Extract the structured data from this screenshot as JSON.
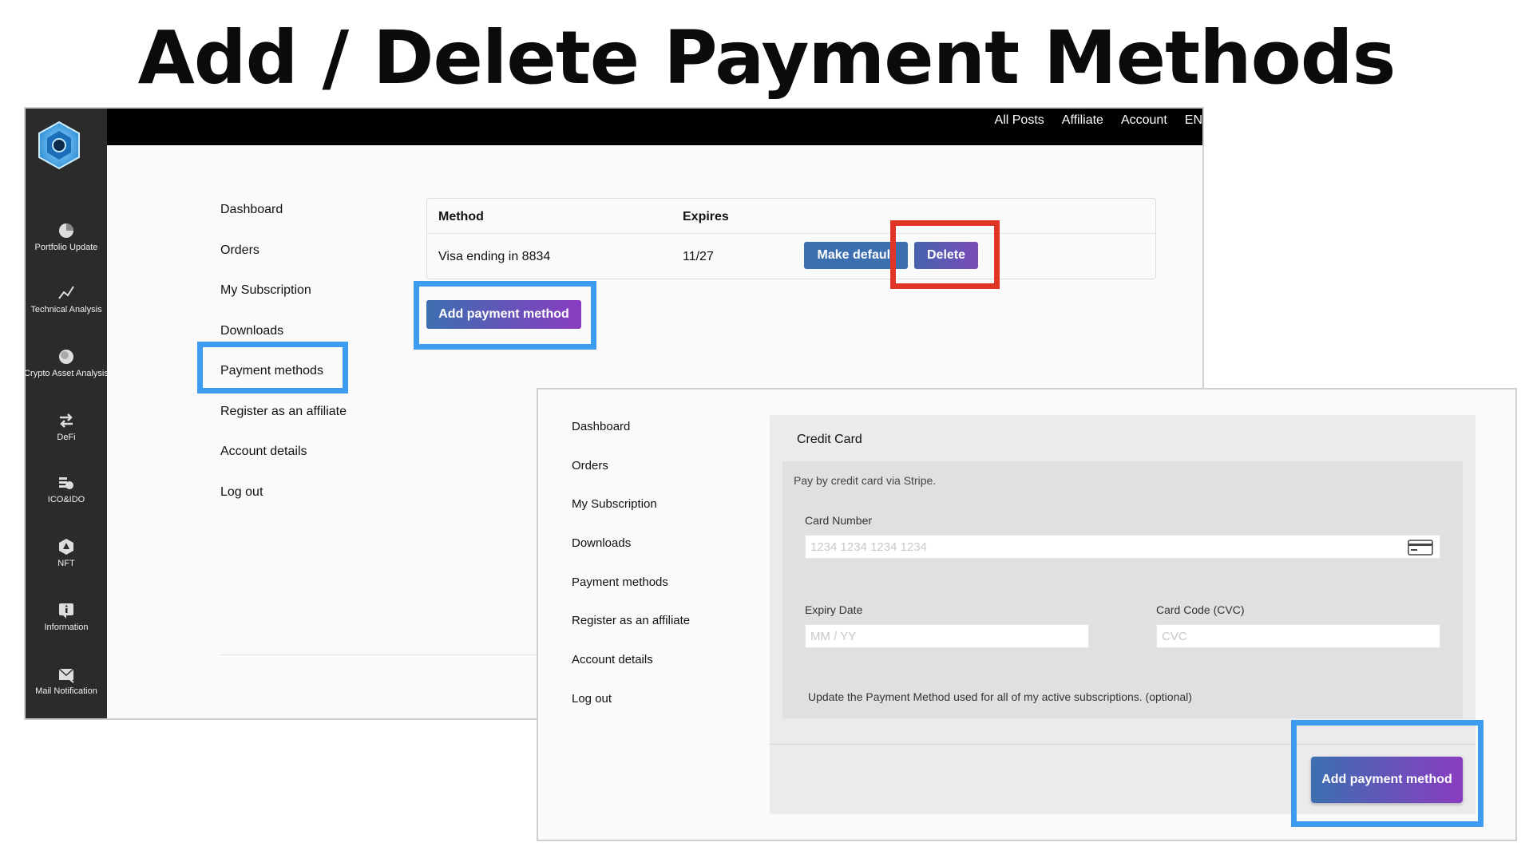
{
  "slide": {
    "title": "Add / Delete Payment Methods"
  },
  "topnav": [
    "All Posts",
    "Affiliate",
    "Account",
    "EN"
  ],
  "sidebar": {
    "items": [
      {
        "label": "Portfolio Update",
        "icon": "pie-chart-icon"
      },
      {
        "label": "Technical Analysis",
        "icon": "line-chart-icon"
      },
      {
        "label": "Crypto Asset Analysis",
        "icon": "coin-icon"
      },
      {
        "label": "DeFi",
        "icon": "swap-arrows-icon"
      },
      {
        "label": "ICO&IDO",
        "icon": "coins-stack-icon"
      },
      {
        "label": "NFT",
        "icon": "nft-hexagon-icon"
      },
      {
        "label": "Information",
        "icon": "info-icon"
      },
      {
        "label": "Mail Notification",
        "icon": "mail-icon"
      }
    ]
  },
  "account_nav": [
    "Dashboard",
    "Orders",
    "My Subscription",
    "Downloads",
    "Payment methods",
    "Register as an affiliate",
    "Account details",
    "Log out"
  ],
  "methods_table": {
    "headers": [
      "Method",
      "Expires"
    ],
    "rows": [
      {
        "method": "Visa ending in 8834",
        "expires": "11/27"
      }
    ],
    "make_default_label": "Make default",
    "delete_label": "Delete"
  },
  "add_button_label": "Add payment method",
  "payment_form": {
    "tab_label": "Credit Card",
    "description": "Pay by credit card via Stripe.",
    "card_number_label": "Card Number",
    "card_number_placeholder": "1234 1234 1234 1234",
    "expiry_label": "Expiry Date",
    "expiry_placeholder": "MM / YY",
    "cvc_label": "Card Code (CVC)",
    "cvc_placeholder": "CVC",
    "update_note": "Update the Payment Method used for all of my active subscriptions. (optional)",
    "submit_label": "Add payment method"
  },
  "colors": {
    "highlight_blue": "#3d9bf0",
    "highlight_red": "#e03526",
    "button_blue": "#3c6fb0",
    "button_purple": "#8a3cc0",
    "sidebar_bg": "#2b2b2b"
  }
}
